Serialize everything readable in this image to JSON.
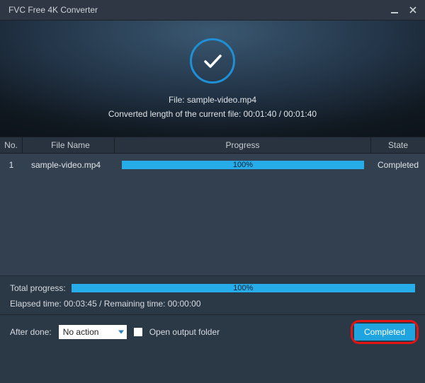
{
  "window_title": "FVC Free 4K Converter",
  "hero": {
    "file_line": "File: sample-video.mp4",
    "converted_line": "Converted length of the current file: 00:01:40 / 00:01:40"
  },
  "table": {
    "headers": {
      "no": "No.",
      "name": "File Name",
      "progress": "Progress",
      "state": "State"
    },
    "rows": [
      {
        "no": "1",
        "name": "sample-video.mp4",
        "progress_label": "100%",
        "state": "Completed"
      }
    ]
  },
  "summary": {
    "total_label": "Total progress:",
    "total_percent_label": "100%",
    "elapsed_line": "Elapsed time: 00:03:45 / Remaining time: 00:00:00"
  },
  "footer": {
    "after_done_label": "After done:",
    "select_value": "No action",
    "open_output_label": "Open output folder",
    "completed_button": "Completed"
  }
}
